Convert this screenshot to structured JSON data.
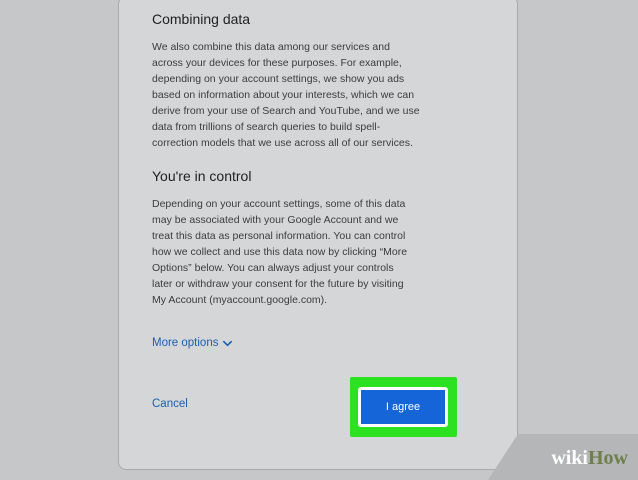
{
  "sections": [
    {
      "heading": "Combining data",
      "lines": [
        "We also combine this data among our services and",
        "across your devices for these purposes. For example,",
        "depending on your account settings, we show you ads",
        "based on information about your interests, which we can",
        "derive from your use of Search and YouTube, and we use",
        "data from trillions of search queries to build spell-",
        "correction models that we use across all of our services."
      ]
    },
    {
      "heading": "You're in control",
      "lines": [
        "Depending on your account settings, some of this data",
        "may be associated with your Google Account and we",
        "treat this data as personal information. You can control",
        "how we collect and use this data now by clicking “More",
        "Options” below. You can always adjust your controls",
        "later or withdraw your consent for the future by visiting",
        "My Account (myaccount.google.com)."
      ]
    }
  ],
  "actions": {
    "more_options_label": "More options",
    "cancel_label": "Cancel",
    "agree_label": "I agree"
  },
  "watermark": {
    "wiki": "wiki",
    "how": "How"
  },
  "colors": {
    "link": "#1a5fb4",
    "primary_button": "#1565d8",
    "highlight": "#2ce022"
  },
  "icons": {
    "more_options": "chevron-down-icon"
  }
}
